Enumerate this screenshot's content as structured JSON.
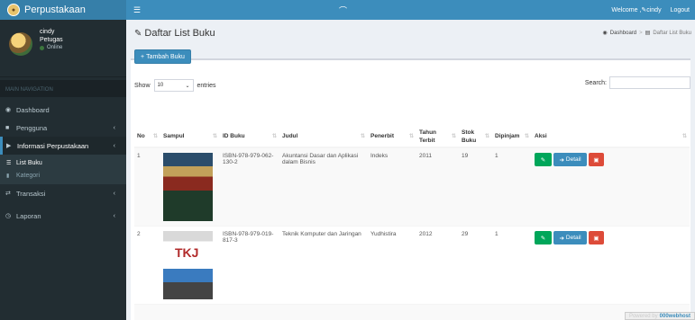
{
  "header": {
    "logo_icon": "library-logo",
    "app_title": "Perpustakaan",
    "center_glyph": "⌒",
    "welcome_label": "Welcome ,",
    "welcome_user": "cindy",
    "logout_label": "Logout",
    "color": "#3c8dbc"
  },
  "sidebar": {
    "user": {
      "name": "cindy",
      "role": "Petugas",
      "status": "Online"
    },
    "nav_header": "MAIN NAVIGATION",
    "items": [
      {
        "label": "Dashboard",
        "icon": "dashboard-icon"
      },
      {
        "label": "Pengguna",
        "icon": "user-icon",
        "chevron": "‹"
      },
      {
        "label": "Informasi Perpustakaan",
        "icon": "book-open-icon",
        "chevron": "‹"
      },
      {
        "label": "Transaksi",
        "icon": "exchange-icon",
        "chevron": "‹"
      },
      {
        "label": "Laporan",
        "icon": "clock-icon",
        "chevron": "‹"
      }
    ],
    "subitems": [
      {
        "label": "List Buku",
        "icon": "list-icon"
      },
      {
        "label": "Kategori",
        "icon": "book-icon"
      }
    ]
  },
  "page": {
    "title": "Daftar List Buku",
    "breadcrumb": {
      "home": "Dashboard",
      "current": "Daftar List Buku"
    }
  },
  "toolbar": {
    "add_label": "Tambah Buku"
  },
  "table_controls": {
    "show_label": "Show",
    "length_value": "10",
    "entries_label": "entries",
    "search_label": "Search:"
  },
  "table": {
    "columns": [
      "No",
      "Sampul",
      "ID Buku",
      "Judul",
      "Penerbit",
      "Tahun Terbit",
      "Stok Buku",
      "Dipinjam",
      "Aksi"
    ],
    "rows": [
      {
        "no": "1",
        "id": "ISBN-978-979-062-130-2",
        "judul": "Akuntansi Dasar dan Aplikasi dalam Bisnis",
        "penerbit": "Indeks",
        "tahun": "2011",
        "stok": "19",
        "dipinjam": "1",
        "cover_text": ""
      },
      {
        "no": "2",
        "id": "ISBN-978-979-019-817-3",
        "judul": "Teknik Komputer dan Jaringan",
        "penerbit": "Yudhistira",
        "tahun": "2012",
        "stok": "29",
        "dipinjam": "1",
        "cover_text": "TKJ"
      }
    ],
    "actions": {
      "detail_label": "Detail"
    }
  },
  "footer": {
    "powered_label": "Powered by",
    "powered_brand": "000webhost"
  }
}
